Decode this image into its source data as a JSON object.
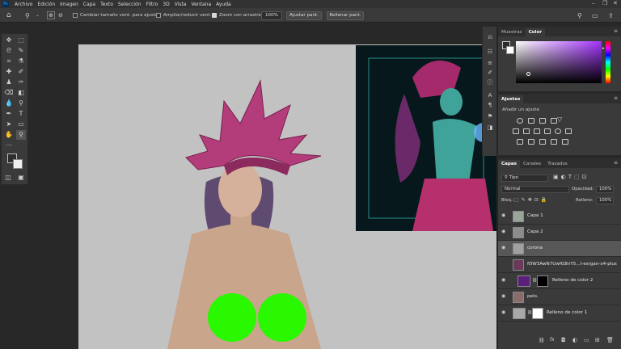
{
  "menubar": {
    "items": [
      "Archivo",
      "Edición",
      "Imagen",
      "Capa",
      "Texto",
      "Selección",
      "Filtro",
      "3D",
      "Vista",
      "Ventana",
      "Ayuda"
    ],
    "logo": "Ps"
  },
  "options": {
    "resize_windows_label": "Cambiar tamaño vent. para ajustar",
    "zoom_all_label": "Ampliar/reducir vent.",
    "scrubby_zoom_label": "Zoom con arrastre",
    "zoom_value": "100%",
    "fit_screen_label": "Ajustar pant.",
    "fill_screen_label": "Rellenar pant."
  },
  "color_panel": {
    "tabs": [
      "Muestras",
      "Color"
    ],
    "active_tab": "Color",
    "hue_color": "#a533ff"
  },
  "adjustments_panel": {
    "title": "Ajustes",
    "add_label": "Añadir un ajuste"
  },
  "layers_panel": {
    "tabs": [
      "Capas",
      "Canales",
      "Trazados"
    ],
    "filter_kind": "Tipo",
    "blend_mode": "Normal",
    "opacity_label": "Opacidad:",
    "opacity_value": "100%",
    "lock_label": "Bloq.:",
    "fill_label": "Relleno:",
    "fill_value": "100%",
    "layers": [
      {
        "name": "Capa 1",
        "visible": true
      },
      {
        "name": "Capa 2",
        "visible": true
      },
      {
        "name": "corona",
        "visible": true,
        "selected": true
      },
      {
        "name": "fDW3AwN7UwfG8nY5...l-esrgan-x4-plus",
        "visible": false
      },
      {
        "name": "Relleno de color 2",
        "visible": true
      },
      {
        "name": "pelo.",
        "visible": true
      },
      {
        "name": "Relleno de color 1",
        "visible": true
      }
    ]
  },
  "colors": {
    "accent_green": "#29f800",
    "gradient_purple": "#a533ff"
  }
}
